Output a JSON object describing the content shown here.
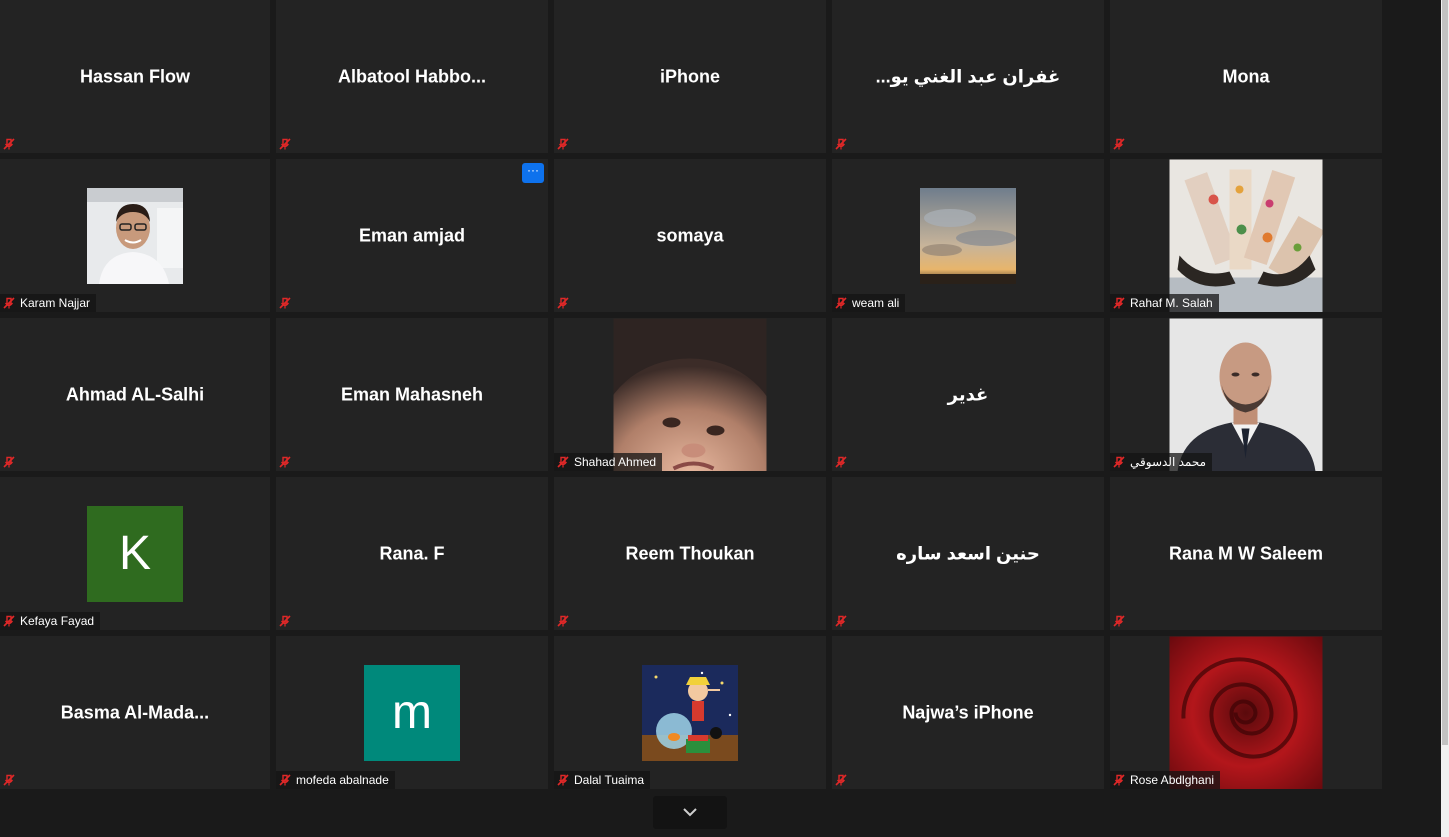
{
  "participants": [
    {
      "name": "Hassan Flow",
      "label": ""
    },
    {
      "name": "Albatool  Habbo...",
      "label": ""
    },
    {
      "name": "iPhone",
      "label": ""
    },
    {
      "name": "...غفران عبد الغني يو",
      "label": ""
    },
    {
      "name": "Mona",
      "label": ""
    },
    {
      "name": "",
      "label": "Karam Najjar"
    },
    {
      "name": "Eman amjad",
      "label": ""
    },
    {
      "name": "somaya",
      "label": ""
    },
    {
      "name": "",
      "label": "weam ali"
    },
    {
      "name": "",
      "label": "Rahaf M. Salah"
    },
    {
      "name": "Ahmad AL-Salhi",
      "label": ""
    },
    {
      "name": "Eman Mahasneh",
      "label": ""
    },
    {
      "name": "",
      "label": "Shahad Ahmed"
    },
    {
      "name": "غدير",
      "label": ""
    },
    {
      "name": "",
      "label": "محمد الدسوقي"
    },
    {
      "name": "",
      "label": "Kefaya Fayad",
      "avatar_letter": "K"
    },
    {
      "name": "Rana. F",
      "label": ""
    },
    {
      "name": "Reem Thoukan",
      "label": ""
    },
    {
      "name": "حنين اسعد ساره",
      "label": ""
    },
    {
      "name": "Rana M W Saleem",
      "label": ""
    },
    {
      "name": "Basma  Al-Mada...",
      "label": ""
    },
    {
      "name": "",
      "label": "mofeda abalnade",
      "avatar_letter": "m"
    },
    {
      "name": "",
      "label": "Dalal Tuaima"
    },
    {
      "name": "Najwa’s iPhone",
      "label": ""
    },
    {
      "name": "",
      "label": "Rose Abdlghani"
    }
  ],
  "more_options_glyph": "···",
  "colors": {
    "tile_bg": "#232323",
    "muted_red": "#e02828",
    "accent_blue": "#0e72ed",
    "avatar_green": "#2f6b1f",
    "avatar_teal": "#00897b"
  },
  "icons": {
    "muted_mic": "mic-muted-icon",
    "page_down": "chevron-down-icon"
  }
}
